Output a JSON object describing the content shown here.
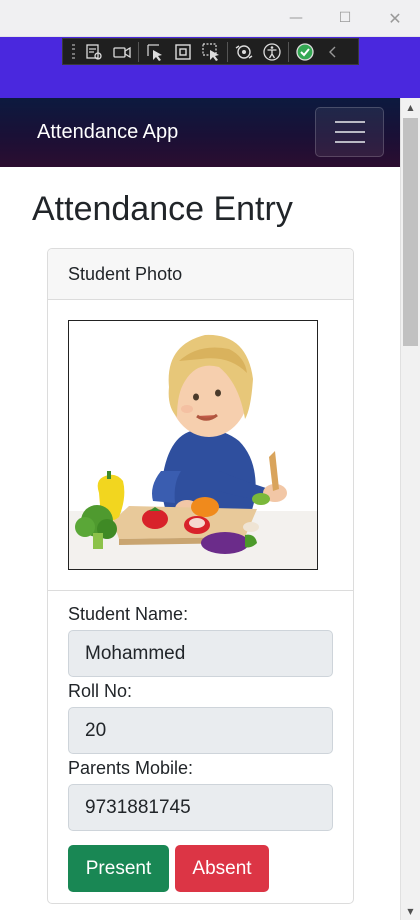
{
  "window": {
    "minimize_glyph": "—",
    "maximize_glyph": "☐",
    "close_glyph": "✕"
  },
  "dev_toolbar": {
    "icons": [
      "select-element-icon",
      "video-icon",
      "pointer-select-icon",
      "frame-icon",
      "region-select-icon",
      "hot-reload-icon",
      "accessibility-icon",
      "check-status-icon",
      "collapse-icon"
    ]
  },
  "navbar": {
    "brand": "Attendance App",
    "toggler_icon": "hamburger-menu-icon"
  },
  "page": {
    "title": "Attendance Entry"
  },
  "card": {
    "header": "Student Photo",
    "photo_alt": "student-photo"
  },
  "form": {
    "name_label": "Student Name:",
    "name_value": "Mohammed",
    "roll_label": "Roll No:",
    "roll_value": "20",
    "mobile_label": "Parents Mobile:",
    "mobile_value": "9731881745"
  },
  "actions": {
    "present_label": "Present",
    "absent_label": "Absent"
  },
  "colors": {
    "host_strip": "#4a28de",
    "present": "#198754",
    "absent": "#dc3545"
  }
}
